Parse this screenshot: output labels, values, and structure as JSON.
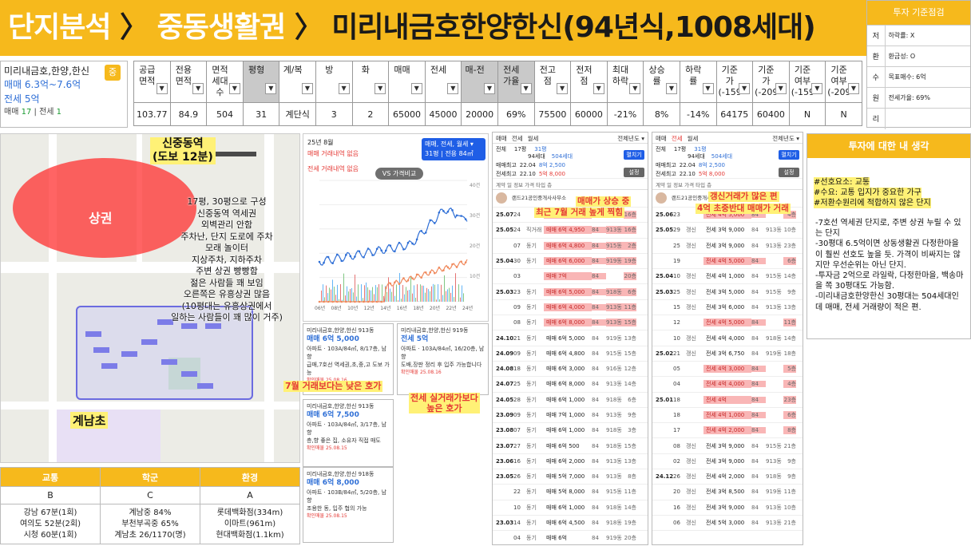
{
  "header": {
    "part1": "단지분석",
    "sep1": "〉",
    "part2": "중동생활권",
    "sep2": "〉",
    "part3": "미리내금호한양한신(94년식,1008세대)"
  },
  "infobox": {
    "name": "미리내금호,한양,한신",
    "badge": "중",
    "sale_range": "매매 6.3억~7.6억",
    "jeonse": "전세 5억",
    "count_prefix": "매매",
    "sale_count": "17",
    "count_sep": "|",
    "jeonse_count_label": "전세",
    "jeonse_count": "1"
  },
  "maintable": {
    "headers": [
      {
        "label": "공급면적",
        "gray": false
      },
      {
        "label": "전용면적",
        "gray": false
      },
      {
        "label": "면적세대수",
        "gray": false
      },
      {
        "label": "평형",
        "gray": true
      },
      {
        "label": "계/복",
        "gray": false
      },
      {
        "label": "방",
        "gray": false
      },
      {
        "label": "화",
        "gray": false
      },
      {
        "label": "매매",
        "gray": false
      },
      {
        "label": "전세",
        "gray": false
      },
      {
        "label": "매-전",
        "gray": true
      },
      {
        "label": "전세가율",
        "gray": true
      },
      {
        "label": "전고점",
        "gray": false
      },
      {
        "label": "전저점",
        "gray": false
      },
      {
        "label": "최대하락",
        "gray": false
      },
      {
        "label": "상승률",
        "gray": false
      },
      {
        "label": "하락률",
        "gray": false
      },
      {
        "label": "기준가(-159",
        "gray": false
      },
      {
        "label": "기준가(-209",
        "gray": false
      },
      {
        "label": "기준여부(-159",
        "gray": false
      },
      {
        "label": "기준여부(-209",
        "gray": false
      }
    ],
    "row": [
      "103.77",
      "84.9",
      "504",
      "31",
      "계단식",
      "3",
      "2",
      "65000",
      "45000",
      "20000",
      "69%",
      "75500",
      "60000",
      "-21%",
      "8%",
      "-14%",
      "64175",
      "60400",
      "N",
      "N"
    ],
    "dropdown_glyph": "▼"
  },
  "invbox": {
    "title": "투자 기준점검",
    "rows": [
      {
        "k": "저",
        "v": "하락률: X"
      },
      {
        "k": "환",
        "v": "환금성: O"
      },
      {
        "k": "수",
        "v": "목표매수: 6억"
      },
      {
        "k": "원",
        "v": "전세가율: 69%"
      },
      {
        "k": "리",
        "v": ""
      }
    ]
  },
  "map": {
    "station": "신중동역",
    "station_walk": "(도보 12분)",
    "ellipse_label": "상권",
    "notes": [
      "17평, 30평으로 구성",
      "신중동역 역세권",
      "외벽관리 안함",
      "주차난, 단지 도로에 주차",
      "모래 놀이터",
      "지상주차, 지하주차",
      "주변 상권 빵빵함",
      "젊은 사람들 꽤 보임",
      "오른쪽은 유흥상권 많음",
      "(10평대는 유흥상권에서",
      "일하는 사람들이 꽤 많이 거주)"
    ],
    "school": "계남초"
  },
  "grades": {
    "headers": [
      "교통",
      "학군",
      "환경"
    ],
    "grades": [
      "B",
      "C",
      "A"
    ],
    "details": [
      [
        "강남 67분(1회)",
        "여의도 52분(2회)",
        "시청 60분(1회)"
      ],
      [
        "계남중 84%",
        "부천부곡중 65%",
        "계남초 26/1170(명)"
      ],
      [
        "롯데백화점(334m)",
        "이마트(961m)",
        "현대백화점(1.1km)"
      ]
    ]
  },
  "pricechart": {
    "month": "25년 8월",
    "sale_none": "매매 거래내역 없음",
    "jeonse_none": "전세 거래내역 없음",
    "box_line1": "매매, 전세, 월세 ▾",
    "box_line2": "31평 | 전용 84㎡",
    "vs": "VS 가격비교",
    "yticks": [
      "10억",
      "8억",
      "6억",
      "4억",
      "2억"
    ],
    "rticks": [
      "40건",
      "30건",
      "20건",
      "10건"
    ],
    "xticks": [
      "06년",
      "08년",
      "10년",
      "12년",
      "14년",
      "16년",
      "18년",
      "20년",
      "22년",
      "24년"
    ]
  },
  "listings": [
    {
      "title": "미리내금호,한양,한신 913동",
      "price": "매매 6억 5,000",
      "desc1": "아파트 · 103A/84㎡, 8/17층, 남향",
      "desc2": "급매,7호선 역세권,초,중,고 도보 가능",
      "date": "확인매물 25.08.16"
    },
    {
      "title": "미리내금호,한양,한신 919동",
      "price": "전세 5억",
      "desc1": "아파트 · 103A/84㎡, 16/20층, 남향",
      "desc2": "도배,장판 정리 후 입주 가능합니다",
      "date": "확인매물 25.08.16"
    },
    {
      "title": "미리내금호,한양,한신 913동",
      "price": "매매 6억 7,500",
      "desc1": "아파트 · 103A/84㎡, 3/17층, 남향",
      "desc2": "층,향 좋은 집, 소유자 직접 매도",
      "date": "확인매물 25.08.15"
    },
    {
      "title": "미리내금호,한양,한신 918동",
      "price": "매매 6억 8,000",
      "desc1": "아파트 · 103B/84㎡, 5/20층, 남향",
      "desc2": "조용한 동, 입주 협의 가능",
      "date": "확인매물 25.08.15"
    }
  ],
  "listing_notes": {
    "lower": "7월 거래보다는 낮은 호가",
    "jeonse1": "전세 실거래가보다",
    "jeonse2": "높은 호가"
  },
  "sale_table": {
    "tabs": [
      "매매",
      "전세",
      "월세"
    ],
    "year": "전체년도 ▾",
    "info_line1_a": "전체",
    "info_line1_b": "17평",
    "info_line1_c": "31평",
    "info_line2_a": "94세대",
    "info_line2_b": "504세대",
    "sale_peak_label": "매매최고",
    "sale_peak_date": "22.04",
    "sale_peak": "8억 2,500",
    "jeonse_peak_label": "전세최고",
    "jeonse_peak_date": "22.10",
    "jeonse_peak": "5억 8,000",
    "btn_fold": "펼치기",
    "btn_set": "설정",
    "colh": "계약  일  정보            가격        타입  층",
    "agent": "랜드21공인중개사사무소",
    "note1": "매매가 상승 중",
    "note2": "최근 7월 거래 높게 찍힘",
    "rows": [
      {
        "d": "25.07",
        "day": "24",
        "k": "",
        "p": "매매 7억 1,000",
        "a": "84",
        "g": "",
        "f": "16층",
        "hi": true
      },
      {
        "d": "25.05",
        "day": "24",
        "k": "직거래",
        "p": "매매 6억 4,950",
        "a": "84",
        "g": "913동",
        "f": "16층",
        "hi": true
      },
      {
        "d": "",
        "day": "07",
        "k": "동기",
        "p": "매매 6억 4,800",
        "a": "84",
        "g": "915동",
        "f": "2층",
        "hi": true
      },
      {
        "d": "25.04",
        "day": "30",
        "k": "동기",
        "p": "매매 6억 6,000",
        "a": "84",
        "g": "919동",
        "f": "19층",
        "hi": true
      },
      {
        "d": "",
        "day": "03",
        "k": "",
        "p": "매매 7억",
        "a": "84",
        "g": "",
        "f": "20층",
        "hi": true
      },
      {
        "d": "25.03",
        "day": "23",
        "k": "동기",
        "p": "매매 6억 5,000",
        "a": "84",
        "g": "918동",
        "f": "6층",
        "hi": true
      },
      {
        "d": "",
        "day": "09",
        "k": "동기",
        "p": "매매 6억 4,000",
        "a": "84",
        "g": "913동",
        "f": "11층",
        "hi": true
      },
      {
        "d": "",
        "day": "08",
        "k": "동기",
        "p": "매매 6억 8,000",
        "a": "84",
        "g": "913동",
        "f": "15층",
        "hi": true
      },
      {
        "d": "24.10",
        "day": "21",
        "k": "동기",
        "p": "매매 6억 5,000",
        "a": "84",
        "g": "919동",
        "f": "13층",
        "hi": false
      },
      {
        "d": "24.09",
        "day": "09",
        "k": "동기",
        "p": "매매 6억 4,800",
        "a": "84",
        "g": "915동",
        "f": "15층",
        "hi": false
      },
      {
        "d": "24.08",
        "day": "18",
        "k": "동기",
        "p": "매매 6억 3,000",
        "a": "84",
        "g": "916동",
        "f": "12층",
        "hi": false
      },
      {
        "d": "24.07",
        "day": "25",
        "k": "동기",
        "p": "매매 6억 8,000",
        "a": "84",
        "g": "913동",
        "f": "14층",
        "hi": false
      },
      {
        "d": "24.05",
        "day": "28",
        "k": "동기",
        "p": "매매 6억 1,000",
        "a": "84",
        "g": "918동",
        "f": "6층",
        "hi": false
      },
      {
        "d": "23.09",
        "day": "09",
        "k": "동기",
        "p": "매매 7억 1,000",
        "a": "84",
        "g": "913동",
        "f": "9층",
        "hi": false
      },
      {
        "d": "23.08",
        "day": "07",
        "k": "동기",
        "p": "매매 6억 1,000",
        "a": "84",
        "g": "918동",
        "f": "3층",
        "hi": false
      },
      {
        "d": "23.07",
        "day": "27",
        "k": "동기",
        "p": "매매 6억 500",
        "a": "84",
        "g": "918동",
        "f": "15층",
        "hi": false
      },
      {
        "d": "23.06",
        "day": "16",
        "k": "동기",
        "p": "매매 6억 2,000",
        "a": "84",
        "g": "913동",
        "f": "13층",
        "hi": false
      },
      {
        "d": "23.05",
        "day": "26",
        "k": "동기",
        "p": "매매 5억 7,000",
        "a": "84",
        "g": "913동",
        "f": "8층",
        "hi": false
      },
      {
        "d": "",
        "day": "22",
        "k": "동기",
        "p": "매매 5억 8,000",
        "a": "84",
        "g": "915동",
        "f": "11층",
        "hi": false
      },
      {
        "d": "",
        "day": "10",
        "k": "동기",
        "p": "매매 6억 1,000",
        "a": "84",
        "g": "918동",
        "f": "14층",
        "hi": false
      },
      {
        "d": "23.03",
        "day": "14",
        "k": "동기",
        "p": "매매 6억 4,500",
        "a": "84",
        "g": "918동",
        "f": "19층",
        "hi": false
      },
      {
        "d": "",
        "day": "04",
        "k": "동기",
        "p": "매매 6억",
        "a": "84",
        "g": "919동",
        "f": "20층",
        "hi": false
      }
    ]
  },
  "jeonse_table": {
    "tabs": [
      "매매",
      "전세",
      "월세"
    ],
    "year": "전체년도 ▾",
    "info_line1_a": "전체",
    "info_line1_b": "17평",
    "info_line1_c": "31평",
    "info_line2_a": "94세대",
    "info_line2_b": "504세대",
    "sale_peak_label": "매매최고",
    "sale_peak_date": "22.04",
    "sale_peak": "8억 2,500",
    "jeonse_peak_label": "전세최고",
    "jeonse_peak_date": "22.10",
    "jeonse_peak": "5억 8,000",
    "btn_fold": "펼치기",
    "btn_set": "설정",
    "colh": "계약  일  정보            가격        타입  층",
    "agent": "랜드21공인중개사사무소",
    "note1": "갱신거래가 많은 편",
    "note2": "4억 초중반대 매매가 거래",
    "rows": [
      {
        "d": "25.06",
        "day": "23",
        "k": "",
        "p": "전세 4억 5,000",
        "a": "84",
        "g": "",
        "f": "4층",
        "hi": true
      },
      {
        "d": "25.05",
        "day": "29",
        "k": "갱신",
        "p": "전세 3억 9,000",
        "a": "84",
        "g": "913동",
        "f": "10층",
        "hi": false
      },
      {
        "d": "",
        "day": "25",
        "k": "갱신",
        "p": "전세 3억 9,000",
        "a": "84",
        "g": "913동",
        "f": "23층",
        "hi": false
      },
      {
        "d": "",
        "day": "19",
        "k": "",
        "p": "전세 4억 5,000",
        "a": "84",
        "g": "",
        "f": "6층",
        "hi": true
      },
      {
        "d": "25.04",
        "day": "10",
        "k": "갱신",
        "p": "전세 4억 1,000",
        "a": "84",
        "g": "915동",
        "f": "14층",
        "hi": false
      },
      {
        "d": "25.03",
        "day": "25",
        "k": "갱신",
        "p": "전세 3억 5,000",
        "a": "84",
        "g": "915동",
        "f": "9층",
        "hi": false
      },
      {
        "d": "",
        "day": "15",
        "k": "갱신",
        "p": "전세 3억 6,000",
        "a": "84",
        "g": "913동",
        "f": "13층",
        "hi": false
      },
      {
        "d": "",
        "day": "12",
        "k": "",
        "p": "전세 4억 5,000",
        "a": "84",
        "g": "",
        "f": "11층",
        "hi": true
      },
      {
        "d": "",
        "day": "10",
        "k": "갱신",
        "p": "전세 4억 4,000",
        "a": "84",
        "g": "918동",
        "f": "14층",
        "hi": false
      },
      {
        "d": "25.02",
        "day": "21",
        "k": "갱신",
        "p": "전세 3억 6,750",
        "a": "84",
        "g": "919동",
        "f": "18층",
        "hi": false
      },
      {
        "d": "",
        "day": "05",
        "k": "",
        "p": "전세 4억 3,000",
        "a": "84",
        "g": "",
        "f": "5층",
        "hi": true
      },
      {
        "d": "",
        "day": "04",
        "k": "",
        "p": "전세 4억 4,000",
        "a": "84",
        "g": "",
        "f": "4층",
        "hi": true
      },
      {
        "d": "25.01",
        "day": "18",
        "k": "",
        "p": "전세 4억",
        "a": "84",
        "g": "",
        "f": "23층",
        "hi": true
      },
      {
        "d": "",
        "day": "18",
        "k": "",
        "p": "전세 4억 1,000",
        "a": "84",
        "g": "",
        "f": "6층",
        "hi": true
      },
      {
        "d": "",
        "day": "17",
        "k": "",
        "p": "전세 4억 2,000",
        "a": "84",
        "g": "",
        "f": "8층",
        "hi": true
      },
      {
        "d": "",
        "day": "08",
        "k": "갱신",
        "p": "전세 3억 9,000",
        "a": "84",
        "g": "915동",
        "f": "21층",
        "hi": false
      },
      {
        "d": "",
        "day": "02",
        "k": "갱신",
        "p": "전세 3억 9,000",
        "a": "84",
        "g": "913동",
        "f": "9층",
        "hi": false
      },
      {
        "d": "24.12",
        "day": "26",
        "k": "갱신",
        "p": "전세 4억 2,000",
        "a": "84",
        "g": "918동",
        "f": "9층",
        "hi": false
      },
      {
        "d": "",
        "day": "20",
        "k": "갱신",
        "p": "전세 3억 8,500",
        "a": "84",
        "g": "919동",
        "f": "11층",
        "hi": false
      },
      {
        "d": "",
        "day": "16",
        "k": "갱신",
        "p": "전세 3억 9,000",
        "a": "84",
        "g": "913동",
        "f": "10층",
        "hi": false
      },
      {
        "d": "",
        "day": "06",
        "k": "갱신",
        "p": "전세 5억 3,000",
        "a": "84",
        "g": "913동",
        "f": "21층",
        "hi": false
      }
    ]
  },
  "opinion": {
    "title": "투자에 대한 내 생각",
    "tag1": "#선호요소: 교통",
    "tag2": "#수요: 교통 입지가 중요한 가구",
    "tag3": "#저환수원리에 적합하지 않은 단지",
    "p1": "-7호선 역세권 단지로, 주변 상권 누릴 수 있는 단지",
    "p2": "-30평대 6.5억이면 상동생활권 다정한마을이 훨씬 선호도 높을 듯. 가격이 비싸지는 않지만 우선순위는 아닌 단지.",
    "p3": "-투자금 2억으로 라일락, 다정한마을, 백송마을 쪽 30평대도 가능함.",
    "p4": "-미리내금호한양한신 30평대는 504세대인데 매매, 전세 거래량이 적은 편."
  },
  "colors": {
    "accent": "#f6b91c",
    "sale_line": "#2f6fd6",
    "jeonse_line": "#f08a5d",
    "highlight": "#f9b6b6",
    "note": "#fff176"
  }
}
